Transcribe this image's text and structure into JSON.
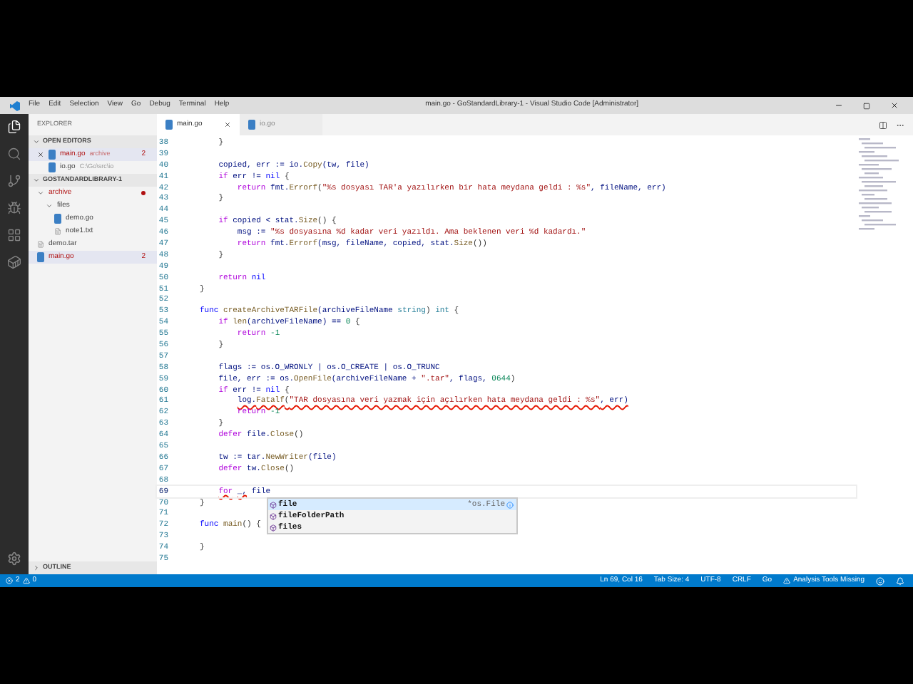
{
  "window": {
    "title": "main.go - GoStandardLibrary-1 - Visual Studio Code [Administrator]"
  },
  "menu": [
    "File",
    "Edit",
    "Selection",
    "View",
    "Go",
    "Debug",
    "Terminal",
    "Help"
  ],
  "activity_bar": [
    {
      "kind": "files",
      "selected": true
    },
    {
      "kind": "search",
      "selected": false
    },
    {
      "kind": "scm",
      "selected": false
    },
    {
      "kind": "debug",
      "selected": false
    },
    {
      "kind": "extensions",
      "selected": false
    },
    {
      "kind": "docker",
      "selected": false
    }
  ],
  "sidebar": {
    "title": "EXPLORER",
    "open_editors": {
      "title": "OPEN EDITORS",
      "expanded": true,
      "items": [
        {
          "name": "main.go",
          "path": "archive",
          "badge": "2",
          "error": true,
          "selected": true
        },
        {
          "name": "io.go",
          "path": "C:\\Go\\src\\io",
          "error": false,
          "selected": false
        }
      ]
    },
    "project": {
      "title": "GOSTANDARDLIBRARY-1",
      "expanded": true,
      "items": [
        {
          "name": "archive",
          "kind": "folder",
          "expanded": true,
          "error": true,
          "selected": false,
          "children": [
            {
              "name": "files",
              "kind": "folder",
              "expanded": true,
              "error": false,
              "selected": false,
              "children": [
                {
                  "name": "demo.go",
                  "kind": "go",
                  "error": false,
                  "selected": false
                },
                {
                  "name": "note1.txt",
                  "kind": "text",
                  "error": false,
                  "selected": false
                }
              ]
            }
          ]
        },
        {
          "name": "demo.tar",
          "kind": "text",
          "error": false,
          "selected": false
        },
        {
          "name": "main.go",
          "kind": "go",
          "badge": "2",
          "error": true,
          "selected": true
        }
      ]
    },
    "outline": {
      "title": "OUTLINE",
      "expanded": false
    }
  },
  "tabs": [
    {
      "name": "main.go",
      "selected": true
    },
    {
      "name": "io.go",
      "selected": false
    }
  ],
  "code": [
    {
      "no": "38",
      "tokens": [
        {
          "t": "    }",
          "kind": "p"
        }
      ]
    },
    {
      "no": "39"
    },
    {
      "no": "40",
      "tokens": [
        {
          "t": "    copied, err := io.",
          "kind": "v"
        },
        {
          "t": "Copy",
          "kind": "fn"
        },
        {
          "t": "(tw, file)",
          "kind": "v"
        }
      ]
    },
    {
      "no": "41",
      "tokens": [
        {
          "t": "    if",
          "kind": "ctl"
        },
        {
          "t": " err != ",
          "kind": "v"
        },
        {
          "t": "nil",
          "kind": "kw"
        },
        {
          "t": " {",
          "kind": "p"
        }
      ]
    },
    {
      "no": "42",
      "tokens": [
        {
          "t": "        return",
          "kind": "ctl"
        },
        {
          "t": " fmt.",
          "kind": "v"
        },
        {
          "t": "Errorf",
          "kind": "fn"
        },
        {
          "t": "(",
          "kind": "p"
        },
        {
          "t": "\"%s dosyası TAR'a yazılırken bir hata meydana geldi : %s\"",
          "kind": "str"
        },
        {
          "t": ", fileName, err)",
          "kind": "v"
        }
      ]
    },
    {
      "no": "43",
      "tokens": [
        {
          "t": "    }",
          "kind": "p"
        }
      ]
    },
    {
      "no": "44"
    },
    {
      "no": "45",
      "tokens": [
        {
          "t": "    if",
          "kind": "ctl"
        },
        {
          "t": " copied < stat.",
          "kind": "v"
        },
        {
          "t": "Size",
          "kind": "fn"
        },
        {
          "t": "() {",
          "kind": "p"
        }
      ]
    },
    {
      "no": "46",
      "tokens": [
        {
          "t": "        msg := ",
          "kind": "v"
        },
        {
          "t": "\"%s dosyasına %d kadar veri yazıldı. Ama beklenen veri %d kadardı.\"",
          "kind": "str"
        }
      ]
    },
    {
      "no": "47",
      "tokens": [
        {
          "t": "        return",
          "kind": "ctl"
        },
        {
          "t": " fmt.",
          "kind": "v"
        },
        {
          "t": "Errorf",
          "kind": "fn"
        },
        {
          "t": "(msg, fileName, copied, stat.",
          "kind": "v"
        },
        {
          "t": "Size",
          "kind": "fn"
        },
        {
          "t": "())",
          "kind": "p"
        }
      ]
    },
    {
      "no": "48",
      "tokens": [
        {
          "t": "    }",
          "kind": "p"
        }
      ]
    },
    {
      "no": "49"
    },
    {
      "no": "50",
      "tokens": [
        {
          "t": "    return",
          "kind": "ctl"
        },
        {
          "t": " nil",
          "kind": "kw"
        }
      ]
    },
    {
      "no": "51",
      "tokens": [
        {
          "t": "}",
          "kind": "p"
        }
      ]
    },
    {
      "no": "52"
    },
    {
      "no": "53",
      "tokens": [
        {
          "t": "func",
          "kind": "kw"
        },
        {
          "t": " createArchiveTARFile",
          "kind": "fn"
        },
        {
          "t": "(archiveFileName ",
          "kind": "v"
        },
        {
          "t": "string",
          "kind": "type"
        },
        {
          "t": ") ",
          "kind": "p"
        },
        {
          "t": "int",
          "kind": "type"
        },
        {
          "t": " {",
          "kind": "p"
        }
      ]
    },
    {
      "no": "54",
      "tokens": [
        {
          "t": "    if",
          "kind": "ctl"
        },
        {
          "t": " len",
          "kind": "fn"
        },
        {
          "t": "(archiveFileName) == ",
          "kind": "v"
        },
        {
          "t": "0",
          "kind": "num"
        },
        {
          "t": " {",
          "kind": "p"
        }
      ]
    },
    {
      "no": "55",
      "tokens": [
        {
          "t": "        return",
          "kind": "ctl"
        },
        {
          "t": " -1",
          "kind": "num"
        }
      ]
    },
    {
      "no": "56",
      "tokens": [
        {
          "t": "    }",
          "kind": "p"
        }
      ]
    },
    {
      "no": "57"
    },
    {
      "no": "58",
      "tokens": [
        {
          "t": "    flags := os.O_WRONLY | os.O_CREATE | os.O_TRUNC",
          "kind": "v"
        }
      ]
    },
    {
      "no": "59",
      "tokens": [
        {
          "t": "    file, err := os.",
          "kind": "v"
        },
        {
          "t": "OpenFile",
          "kind": "fn"
        },
        {
          "t": "(archiveFileName + ",
          "kind": "v"
        },
        {
          "t": "\".tar\"",
          "kind": "str"
        },
        {
          "t": ", flags, ",
          "kind": "v"
        },
        {
          "t": "0644",
          "kind": "num"
        },
        {
          "t": ")",
          "kind": "p"
        }
      ]
    },
    {
      "no": "60",
      "tokens": [
        {
          "t": "    if",
          "kind": "ctl"
        },
        {
          "t": " err != ",
          "kind": "v"
        },
        {
          "t": "nil",
          "kind": "kw"
        },
        {
          "t": " {",
          "kind": "p"
        }
      ]
    },
    {
      "no": "61",
      "tokens": [
        {
          "t": "        log.",
          "kind": "v",
          "error": true
        },
        {
          "t": "Fatalf",
          "kind": "fn",
          "error": true
        },
        {
          "t": "(",
          "kind": "p",
          "error": true
        },
        {
          "t": "\"TAR dosyasına veri yazmak için açılırken hata meydana geldi : %s\"",
          "kind": "str",
          "error": true
        },
        {
          "t": ", err)",
          "kind": "v",
          "error": true
        }
      ]
    },
    {
      "no": "62",
      "tokens": [
        {
          "t": "        return",
          "kind": "ctl"
        },
        {
          "t": " -1",
          "kind": "num"
        }
      ]
    },
    {
      "no": "63",
      "tokens": [
        {
          "t": "    }",
          "kind": "p"
        }
      ]
    },
    {
      "no": "64",
      "tokens": [
        {
          "t": "    defer",
          "kind": "ctl"
        },
        {
          "t": " file.",
          "kind": "v"
        },
        {
          "t": "Close",
          "kind": "fn"
        },
        {
          "t": "()",
          "kind": "p"
        }
      ]
    },
    {
      "no": "65"
    },
    {
      "no": "66",
      "tokens": [
        {
          "t": "    tw := tar.",
          "kind": "v"
        },
        {
          "t": "NewWriter",
          "kind": "fn"
        },
        {
          "t": "(file)",
          "kind": "v"
        }
      ]
    },
    {
      "no": "67",
      "tokens": [
        {
          "t": "    defer",
          "kind": "ctl"
        },
        {
          "t": " tw.",
          "kind": "v"
        },
        {
          "t": "Close",
          "kind": "fn"
        },
        {
          "t": "()",
          "kind": "p"
        }
      ]
    },
    {
      "no": "68"
    },
    {
      "no": "69",
      "current": true,
      "tokens": [
        {
          "t": "    for",
          "kind": "ctl",
          "error": true
        },
        {
          "t": " _,",
          "kind": "v",
          "error": true
        },
        {
          "t": " file",
          "kind": "v"
        }
      ]
    },
    {
      "no": "70",
      "tokens": [
        {
          "t": "}",
          "kind": "p"
        }
      ]
    },
    {
      "no": "71"
    },
    {
      "no": "72",
      "tokens": [
        {
          "t": "func",
          "kind": "kw"
        },
        {
          "t": " main",
          "kind": "fn"
        },
        {
          "t": "() {",
          "kind": "p"
        }
      ]
    },
    {
      "no": "73"
    },
    {
      "no": "74",
      "tokens": [
        {
          "t": "}",
          "kind": "p"
        }
      ]
    },
    {
      "no": "75"
    }
  ],
  "suggestions": [
    {
      "label": "file",
      "detail": "*os.File",
      "selected": true
    },
    {
      "label": "fileFolderPath",
      "selected": false
    },
    {
      "label": "files",
      "selected": false
    }
  ],
  "status_bar": {
    "errors": "2",
    "warnings": "0",
    "items": [
      "Ln 69, Col 16",
      "Tab Size: 4",
      "UTF-8",
      "CRLF",
      "Go"
    ],
    "alert": "Analysis Tools Missing"
  }
}
